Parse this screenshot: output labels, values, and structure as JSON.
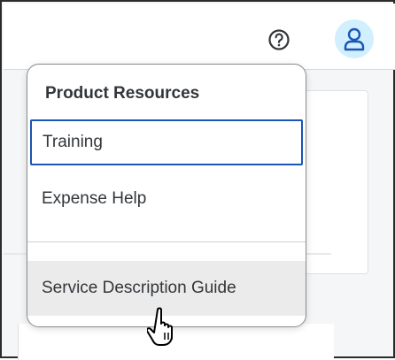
{
  "shellbar": {
    "help_icon": "question-circle-icon",
    "avatar_icon": "person-icon",
    "accent_color": "#1a56b3",
    "avatar_bg": "#d1efff"
  },
  "menu": {
    "title": "Product Resources",
    "items": [
      {
        "label": "Training",
        "state": "focused"
      },
      {
        "label": "Expense Help",
        "state": "default"
      },
      {
        "label": "Service Description Guide",
        "state": "hover"
      }
    ]
  },
  "cursor_icon": "hand-pointer-icon"
}
